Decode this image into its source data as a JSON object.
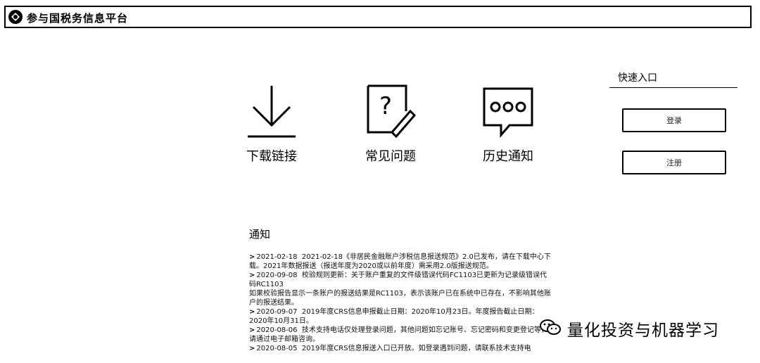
{
  "header": {
    "title": "参与国税务信息平台"
  },
  "tiles": [
    {
      "label": "下载链接",
      "icon": "download-icon"
    },
    {
      "label": "常见问题",
      "icon": "faq-icon"
    },
    {
      "label": "历史通知",
      "icon": "message-icon"
    }
  ],
  "quick_entry": {
    "title": "快速入口",
    "buttons": [
      "登录",
      "注册"
    ]
  },
  "notices": {
    "title": "通知",
    "items": [
      {
        "date": "2021-02-18",
        "text": "2021-02-18《非居民金融账户涉税信息报送规范》2.0已发布，请在下载中心下载。2021年数据报送（报送年度为2020或以前年度）需采用2.0版报送规范。"
      },
      {
        "date": "2020-09-08",
        "text": "校验规则更新：关于账户重复的文件级错误代码FC1103已更新为记录级错误代码RC1103\n如果校验报告显示一条账户的报送结果是RC1103，表示该账户已在系统中已存在，不影响其他账户的报送结果。"
      },
      {
        "date": "2020-09-07",
        "text": "2019年度CRS信息申报截止日期：2020年10月23日。年度报告截止日期：2020年10月31日。"
      },
      {
        "date": "2020-08-06",
        "text": "技术支持电话仅处理登录问题，其他问题如忘记账号、忘记密码和变更登记等，请通过电子邮箱咨询。"
      },
      {
        "date": "2020-08-05",
        "text": "2019年度CRS信息报送入口已开放。如登录遇到问题，请联系技术支持电"
      }
    ]
  },
  "watermark": {
    "text": "量化投资与机器学习",
    "icon": "wechat-icon"
  }
}
